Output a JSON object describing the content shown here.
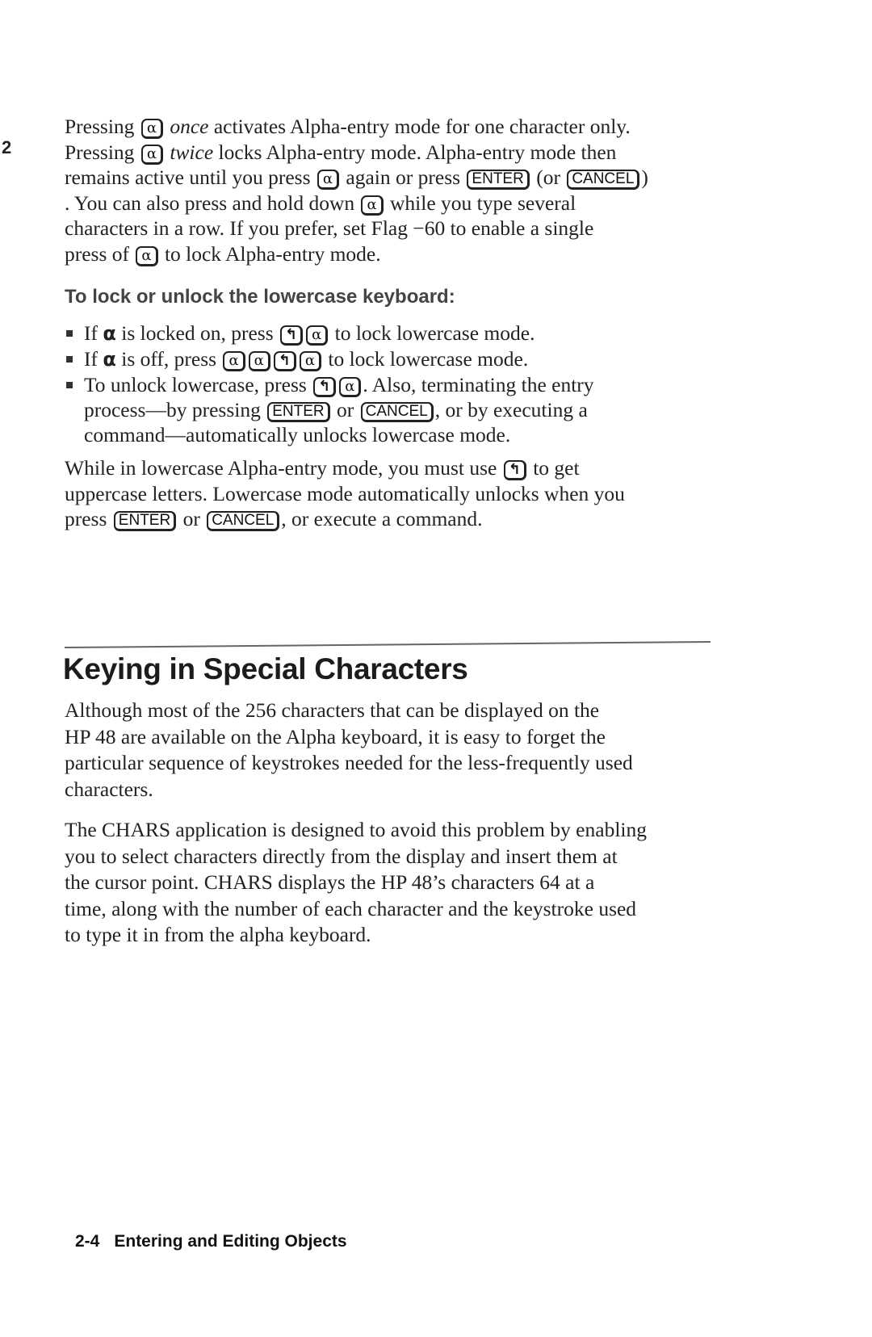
{
  "chapter_tab": "2",
  "intro": {
    "lines": [
      {
        "pre": "Pressing ",
        "key": "α",
        "em": "once",
        "post": " activates Alpha-entry mode for one character only."
      },
      {
        "pre": "Pressing ",
        "key": "α",
        "em": "twice",
        "post": " locks Alpha-entry mode. Alpha-entry mode then"
      },
      {
        "pre": "remains active until you press ",
        "key": "α",
        "mid": " again or press ",
        "key2": "ENTER",
        "mid2": " (or ",
        "key3": "CANCEL",
        "post": ")"
      },
      {
        "pre": ". You can also press and hold down ",
        "key": "α",
        "post": " while you type several"
      },
      {
        "pre": "characters in a row. If you prefer, set Flag −60 to enable a single"
      },
      {
        "pre": "press of ",
        "key": "α",
        "post": " to lock Alpha-entry mode."
      }
    ]
  },
  "subheading": "To lock or unlock the lowercase keyboard:",
  "bullets": [
    {
      "pre": "If ",
      "glyph": "α",
      "mid": " is locked on, press ",
      "keys": [
        "↰",
        "α"
      ],
      "post": " to lock lowercase mode."
    },
    {
      "pre": "If ",
      "glyph": "α",
      "mid": " is off, press ",
      "keys": [
        "α",
        "α",
        "↰",
        "α"
      ],
      "post": " to lock lowercase mode."
    },
    {
      "pre": "To unlock lowercase, press ",
      "keys": [
        "↰",
        "α"
      ],
      "post": ". Also, terminating the entry",
      "cont1_pre": "process—by pressing ",
      "cont1_key": "ENTER",
      "cont1_mid": " or ",
      "cont1_key2": "CANCEL",
      "cont1_post": ", or by executing a",
      "cont2": "command—automatically unlocks lowercase mode."
    }
  ],
  "lowercase_para": {
    "line1_pre": "While in lowercase Alpha-entry mode, you must use ",
    "line1_key": "↰",
    "line1_post": " to get",
    "line2": "uppercase letters. Lowercase mode automatically unlocks when you",
    "line3_pre": "press ",
    "line3_key": "ENTER",
    "line3_mid": " or ",
    "line3_key2": "CANCEL",
    "line3_post": ", or execute a command."
  },
  "section": {
    "title": "Keying in Special Characters",
    "para1": [
      "Although most of the 256 characters that can be displayed on the",
      "HP 48 are available on the Alpha keyboard, it is easy to forget the",
      "particular sequence of keystrokes needed for the less-frequently used",
      "characters."
    ],
    "para2": [
      "The CHARS application is designed to avoid this problem by enabling",
      "you to select characters directly from the display and insert them at",
      "the cursor point. CHARS displays the HP 48’s characters 64 at a",
      "time, along with the number of each character and the keystroke used",
      "to type it in from the alpha keyboard."
    ]
  },
  "footer": {
    "page_number": "2-4",
    "chapter_title": "Entering and Editing Objects"
  }
}
